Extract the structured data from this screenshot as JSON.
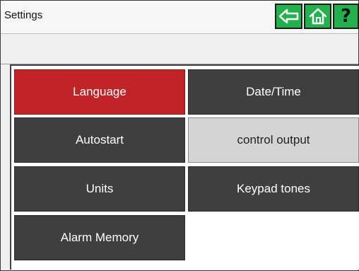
{
  "header": {
    "title": "Settings",
    "back_icon": "arrow-left-icon",
    "home_icon": "home-icon",
    "help_icon": "question-icon",
    "help_label": "?"
  },
  "colors": {
    "header_buttons": "#22b14c",
    "active_tile": "#c02426",
    "tile": "#3f3f3f",
    "light_tile": "#d4d4d4"
  },
  "menu": {
    "items": [
      {
        "label": "Language",
        "state": "selected"
      },
      {
        "label": "Date/Time",
        "state": "normal"
      },
      {
        "label": "Autostart",
        "state": "normal"
      },
      {
        "label": "control output",
        "state": "disabled"
      },
      {
        "label": "Units",
        "state": "normal"
      },
      {
        "label": "Keypad tones",
        "state": "normal"
      },
      {
        "label": "Alarm Memory",
        "state": "normal"
      }
    ]
  }
}
